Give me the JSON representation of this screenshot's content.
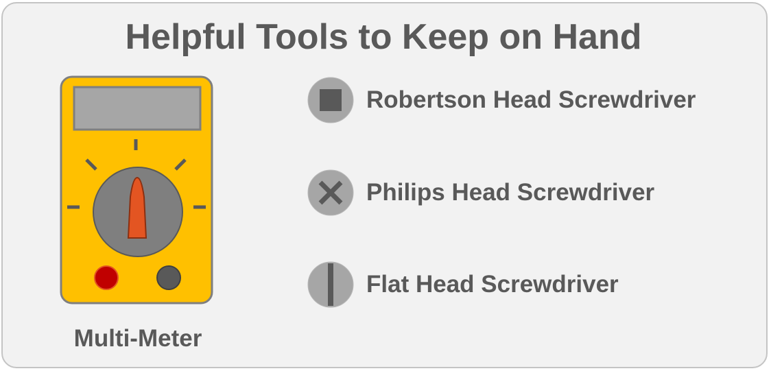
{
  "title": "Helpful Tools to Keep on Hand",
  "multimeter": {
    "label": "Multi-Meter",
    "icon": "multimeter-icon",
    "colors": {
      "body": "#ffc000",
      "screen": "#a6a6a6",
      "dial": "#7f7f7f",
      "pointer": "#e35522",
      "port_red": "#c00000",
      "port_black": "#595959"
    }
  },
  "tools": [
    {
      "label": "Robertson Head Screwdriver",
      "icon": "robertson-screw-head-icon"
    },
    {
      "label": "Philips Head Screwdriver",
      "icon": "philips-screw-head-icon"
    },
    {
      "label": "Flat Head Screwdriver",
      "icon": "flat-screw-head-icon"
    }
  ],
  "colors": {
    "text": "#595959",
    "background": "#f2f2f2",
    "border": "#c4c4c4",
    "screw_head": "#a6a6a6",
    "screw_slot": "#595959"
  }
}
